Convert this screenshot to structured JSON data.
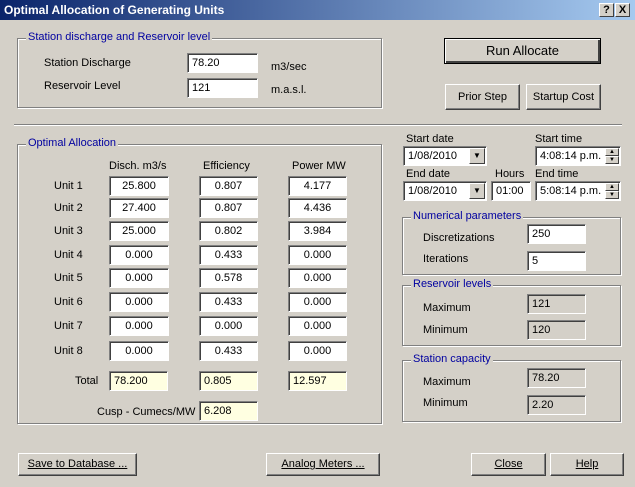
{
  "window": {
    "title": "Optimal Allocation of Generating Units",
    "help_btn": "?",
    "close_btn": "X"
  },
  "station": {
    "group_title": "Station discharge and Reservoir level",
    "discharge_label": "Station Discharge",
    "discharge_value": "78.20",
    "discharge_unit": "m3/sec",
    "level_label": "Reservoir Level",
    "level_value": "121",
    "level_unit": "m.a.s.l."
  },
  "buttons": {
    "run_allocate": "Run Allocate",
    "prior_step": "Prior Step",
    "startup_cost": "Startup Cost",
    "save_db": "Save to Database ...",
    "analog_meters": "Analog Meters ...",
    "close": "Close",
    "help": "Help"
  },
  "allocation": {
    "group_title": "Optimal Allocation",
    "col_disch": "Disch. m3/s",
    "col_eff": "Efficiency",
    "col_power": "Power MW",
    "units": [
      {
        "name": "Unit 1",
        "disch": "25.800",
        "eff": "0.807",
        "power": "4.177"
      },
      {
        "name": "Unit 2",
        "disch": "27.400",
        "eff": "0.807",
        "power": "4.436"
      },
      {
        "name": "Unit 3",
        "disch": "25.000",
        "eff": "0.802",
        "power": "3.984"
      },
      {
        "name": "Unit 4",
        "disch": "0.000",
        "eff": "0.433",
        "power": "0.000"
      },
      {
        "name": "Unit 5",
        "disch": "0.000",
        "eff": "0.578",
        "power": "0.000"
      },
      {
        "name": "Unit 6",
        "disch": "0.000",
        "eff": "0.433",
        "power": "0.000"
      },
      {
        "name": "Unit 7",
        "disch": "0.000",
        "eff": "0.000",
        "power": "0.000"
      },
      {
        "name": "Unit 8",
        "disch": "0.000",
        "eff": "0.433",
        "power": "0.000"
      }
    ],
    "total_label": "Total",
    "total_disch": "78.200",
    "total_eff": "0.805",
    "total_power": "12.597",
    "cusp_label": "Cusp - Cumecs/MW",
    "cusp_value": "6.208"
  },
  "timing": {
    "start_date_label": "Start date",
    "start_date": "1/08/2010",
    "start_time_label": "Start time",
    "start_time": "4:08:14 p.m.",
    "end_date_label": "End date",
    "end_date": "1/08/2010",
    "hours_label": "Hours",
    "hours": "01:00",
    "end_time_label": "End time",
    "end_time": "5:08:14 p.m."
  },
  "numerical": {
    "group_title": "Numerical parameters",
    "disc_label": "Discretizations",
    "disc_value": "250",
    "iter_label": "Iterations",
    "iter_value": "5"
  },
  "reservoir": {
    "group_title": "Reservoir levels",
    "max_label": "Maximum",
    "max_value": "121",
    "min_label": "Minimum",
    "min_value": "120"
  },
  "capacity": {
    "group_title": "Station capacity",
    "max_label": "Maximum",
    "max_value": "78.20",
    "min_label": "Minimum",
    "min_value": "2.20"
  }
}
